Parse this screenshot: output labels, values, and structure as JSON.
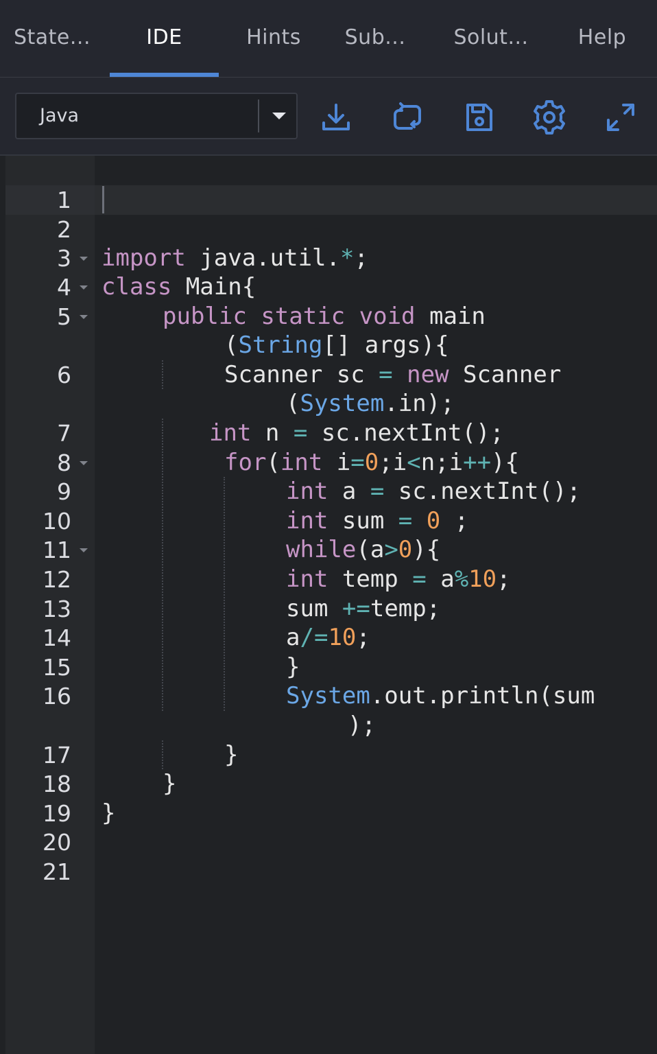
{
  "tabs": [
    {
      "label": "State..."
    },
    {
      "label": "IDE"
    },
    {
      "label": "Hints"
    },
    {
      "label": "Sub..."
    },
    {
      "label": "Solut..."
    },
    {
      "label": "Help"
    }
  ],
  "active_tab": "IDE",
  "toolbar": {
    "language": "Java",
    "icons": [
      "download-icon",
      "reset-icon",
      "save-icon",
      "settings-icon",
      "fullscreen-icon"
    ]
  },
  "colors": {
    "accent": "#4e86d6",
    "keyword": "#c695c6",
    "type": "#6ba7e6",
    "number": "#f0a05a",
    "operator": "#5fb3b3"
  },
  "editor": {
    "line_numbers": [
      "1",
      "2",
      "3",
      "4",
      "5",
      "6",
      "7",
      "8",
      "9",
      "10",
      "11",
      "12",
      "13",
      "14",
      "15",
      "16",
      "17",
      "18",
      "19",
      "20",
      "21"
    ],
    "code": {
      "l3": [
        [
          "import",
          "kw"
        ],
        [
          " java.util.",
          ""
        ],
        [
          "*",
          "op"
        ],
        [
          ";",
          ""
        ]
      ],
      "l4": [
        [
          "class",
          "kw"
        ],
        [
          " Main{",
          ""
        ]
      ],
      "l5a": [
        [
          "public",
          "kw"
        ],
        [
          " ",
          ""
        ],
        [
          "static",
          "kw"
        ],
        [
          " ",
          ""
        ],
        [
          "void",
          "kw"
        ],
        [
          " main",
          ""
        ]
      ],
      "l5b": [
        [
          "(",
          ""
        ],
        [
          "String",
          "ty"
        ],
        [
          "[] args){",
          ""
        ]
      ],
      "l6a": [
        [
          "Scanner sc ",
          ""
        ],
        [
          "=",
          "op"
        ],
        [
          " ",
          ""
        ],
        [
          "new",
          "kw"
        ],
        [
          " Scanner",
          ""
        ]
      ],
      "l6b": [
        [
          "(",
          ""
        ],
        [
          "System",
          "ty"
        ],
        [
          ".in);",
          ""
        ]
      ],
      "l7": [
        [
          "int",
          "kw"
        ],
        [
          " n ",
          ""
        ],
        [
          "=",
          "op"
        ],
        [
          " sc.nextInt();",
          ""
        ]
      ],
      "l8": [
        [
          "for",
          "kw"
        ],
        [
          "(",
          ""
        ],
        [
          "int",
          "kw"
        ],
        [
          " i",
          ""
        ],
        [
          "=",
          "op"
        ],
        [
          "0",
          "num"
        ],
        [
          ";i",
          ""
        ],
        [
          "<",
          "op"
        ],
        [
          "n;i",
          ""
        ],
        [
          "++",
          "op"
        ],
        [
          "){",
          ""
        ]
      ],
      "l9": [
        [
          "int",
          "kw"
        ],
        [
          " a ",
          ""
        ],
        [
          "=",
          "op"
        ],
        [
          " sc.nextInt();",
          ""
        ]
      ],
      "l10": [
        [
          "int",
          "kw"
        ],
        [
          " sum ",
          ""
        ],
        [
          "=",
          "op"
        ],
        [
          " ",
          ""
        ],
        [
          "0",
          "num"
        ],
        [
          " ;",
          ""
        ]
      ],
      "l11": [
        [
          "while",
          "kw"
        ],
        [
          "(a",
          ""
        ],
        [
          ">",
          "op"
        ],
        [
          "0",
          "num"
        ],
        [
          "){",
          ""
        ]
      ],
      "l12": [
        [
          "int",
          "kw"
        ],
        [
          " temp ",
          ""
        ],
        [
          "=",
          "op"
        ],
        [
          " a",
          ""
        ],
        [
          "%",
          "op"
        ],
        [
          "10",
          "num"
        ],
        [
          ";",
          ""
        ]
      ],
      "l13": [
        [
          "sum ",
          ""
        ],
        [
          "+=",
          "op"
        ],
        [
          "temp;",
          ""
        ]
      ],
      "l14": [
        [
          "a",
          ""
        ],
        [
          "/=",
          "op"
        ],
        [
          "10",
          "num"
        ],
        [
          ";",
          ""
        ]
      ],
      "l15": [
        [
          "}",
          ""
        ]
      ],
      "l16a": [
        [
          "System",
          "ty"
        ],
        [
          ".out.println(sum",
          ""
        ]
      ],
      "l16b": [
        [
          ");",
          ""
        ]
      ],
      "l17": [
        [
          "}",
          ""
        ]
      ],
      "l18": [
        [
          "}",
          ""
        ]
      ],
      "l19": [
        [
          "}",
          ""
        ]
      ]
    }
  }
}
